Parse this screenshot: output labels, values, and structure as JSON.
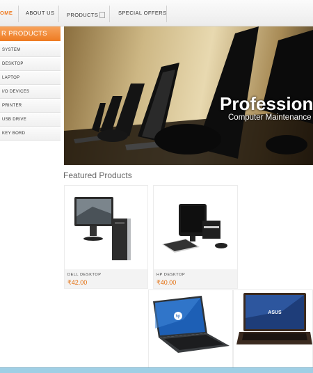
{
  "nav": {
    "items": [
      "OME",
      "ABOUT US",
      "PRODUCTS",
      "SPECIAL OFFERS"
    ]
  },
  "sidebar": {
    "title": "R PRODUCTS",
    "items": [
      "SYSTEM",
      "DESKTOP",
      "LAPTOP",
      "I/O DEVICES",
      "PRINTER",
      "USB DRIVE",
      "KEY BORD"
    ]
  },
  "banner": {
    "title": "Professional",
    "subtitle": "Computer Maintenance"
  },
  "featured": {
    "heading": "Featured Products",
    "products": [
      {
        "name": "DELL DESKTOP",
        "price": "₹42.00"
      },
      {
        "name": "HP DESKTOP",
        "price": "₹40.00"
      }
    ]
  },
  "colors": {
    "accent": "#ee7b22",
    "price": "#e36c0a"
  }
}
